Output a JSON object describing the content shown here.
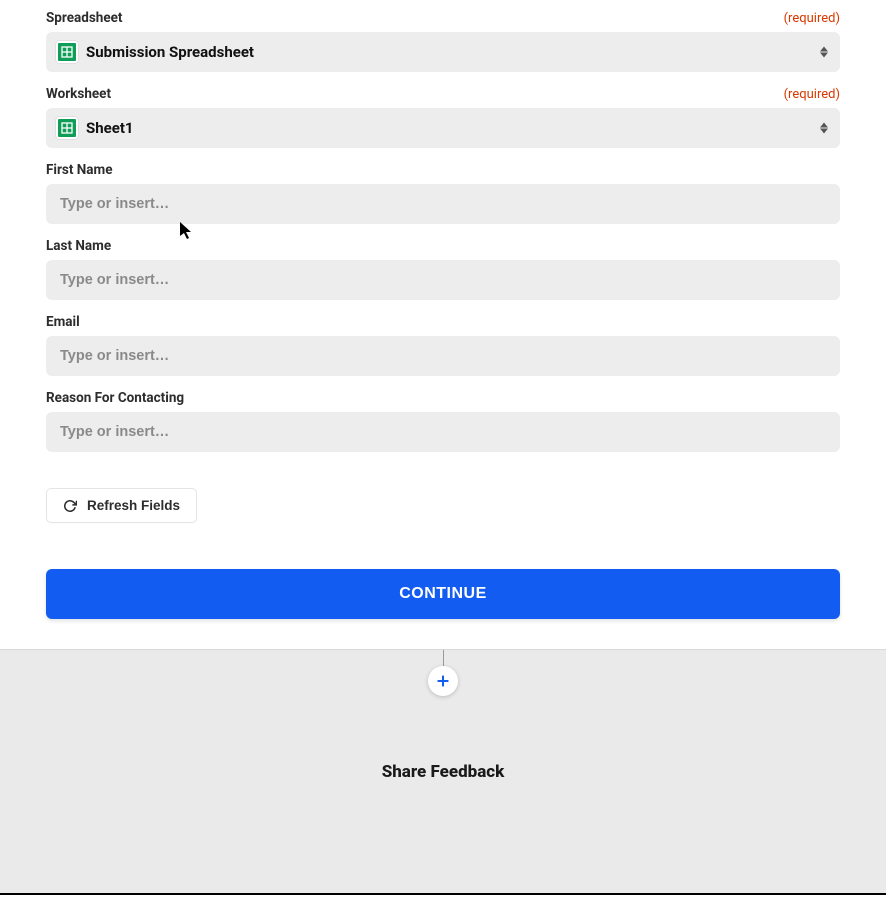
{
  "fields": {
    "spreadsheet": {
      "label": "Spreadsheet",
      "required": "(required)",
      "value": "Submission Spreadsheet"
    },
    "worksheet": {
      "label": "Worksheet",
      "required": "(required)",
      "value": "Sheet1"
    },
    "first_name": {
      "label": "First Name",
      "placeholder": "Type or insert…"
    },
    "last_name": {
      "label": "Last Name",
      "placeholder": "Type or insert…"
    },
    "email": {
      "label": "Email",
      "placeholder": "Type or insert…"
    },
    "reason": {
      "label": "Reason For Contacting",
      "placeholder": "Type or insert…"
    }
  },
  "buttons": {
    "refresh": "Refresh Fields",
    "continue": "CONTINUE"
  },
  "footer": {
    "share": "Share Feedback"
  }
}
